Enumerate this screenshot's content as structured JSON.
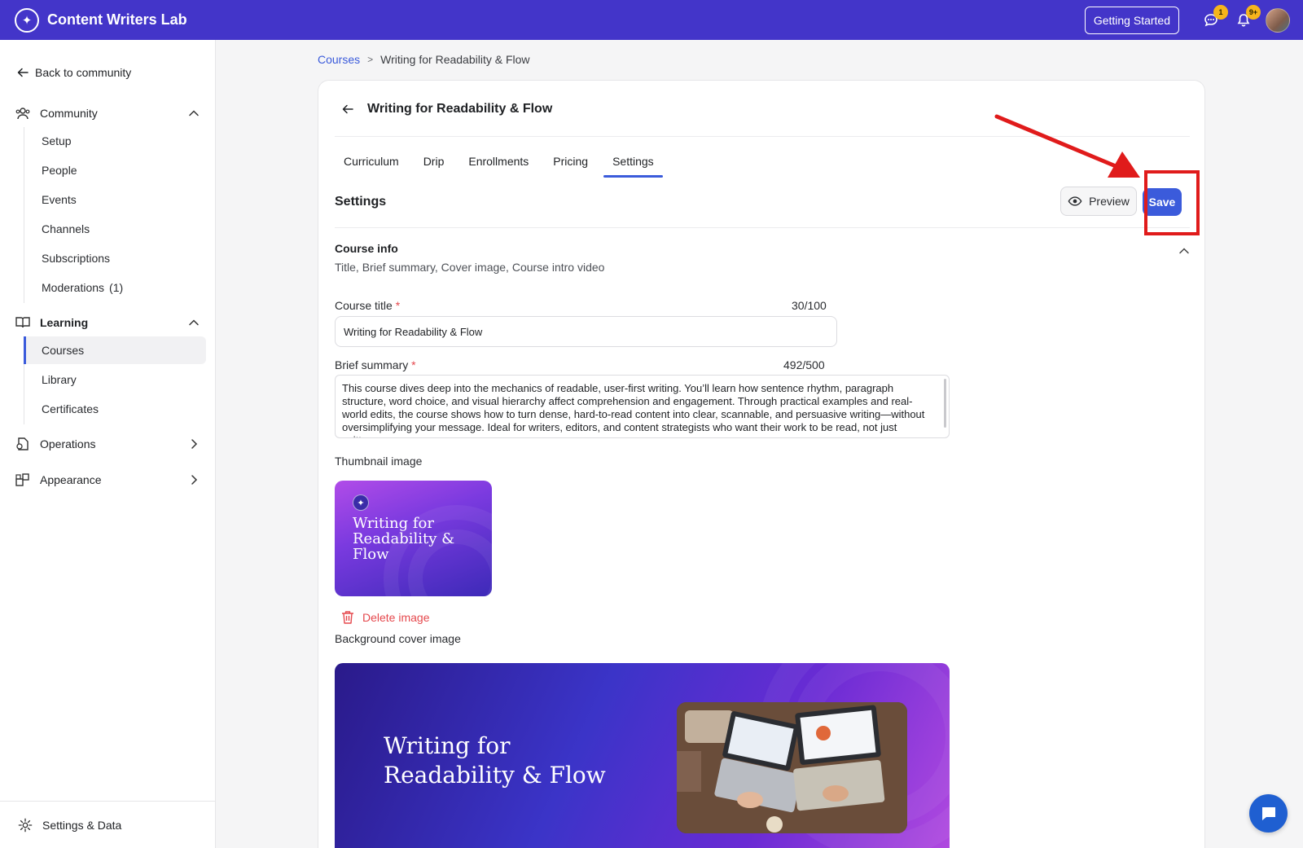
{
  "app": {
    "name": "Content Writers Lab",
    "getting_started": "Getting Started",
    "messages_badge": "1",
    "notifications_badge": "9+"
  },
  "sidebar": {
    "back": "Back to community",
    "community": {
      "label": "Community",
      "items": [
        "Setup",
        "People",
        "Events",
        "Channels",
        "Subscriptions",
        "Moderations"
      ],
      "moderations_count": "(1)"
    },
    "learning": {
      "label": "Learning",
      "items": [
        "Courses",
        "Library",
        "Certificates"
      ],
      "active": "Courses"
    },
    "operations": "Operations",
    "appearance": "Appearance",
    "footer": "Settings & Data"
  },
  "breadcrumb": {
    "root": "Courses",
    "current": "Writing for Readability & Flow"
  },
  "course": {
    "title": "Writing for Readability & Flow",
    "tabs": [
      "Curriculum",
      "Drip",
      "Enrollments",
      "Pricing",
      "Settings"
    ],
    "active_tab": "Settings"
  },
  "settings": {
    "heading": "Settings",
    "preview": "Preview",
    "save": "Save",
    "course_info": {
      "title": "Course info",
      "subtitle": "Title, Brief summary, Cover image, Course intro video"
    },
    "course_title": {
      "label": "Course title",
      "required": "*",
      "count": "30/100",
      "value": "Writing for Readability & Flow"
    },
    "brief_summary": {
      "label": "Brief summary",
      "required": "*",
      "count": "492/500",
      "value": "This course dives deep into the mechanics of readable, user-first writing. You’ll learn how sentence rhythm, paragraph structure, word choice, and visual hierarchy affect comprehension and engagement. Through practical examples and real-world edits, the course shows how to turn dense, hard-to-read content into clear, scannable, and persuasive writing—without oversimplifying your message. Ideal for writers, editors, and content strategists who want their work to be read, not just written."
    },
    "thumbnail": {
      "label": "Thumbnail image",
      "image_text": "Writing for Readability & Flow",
      "delete": "Delete image"
    },
    "cover": {
      "label": "Background cover image",
      "line1": "Writing for",
      "line2": "Readability & Flow"
    }
  },
  "colors": {
    "topbar": "#4335c9",
    "accent": "#3b5bdb",
    "danger": "#e5484d",
    "annotation": "#e01b1b",
    "badge": "#f6b51c"
  }
}
